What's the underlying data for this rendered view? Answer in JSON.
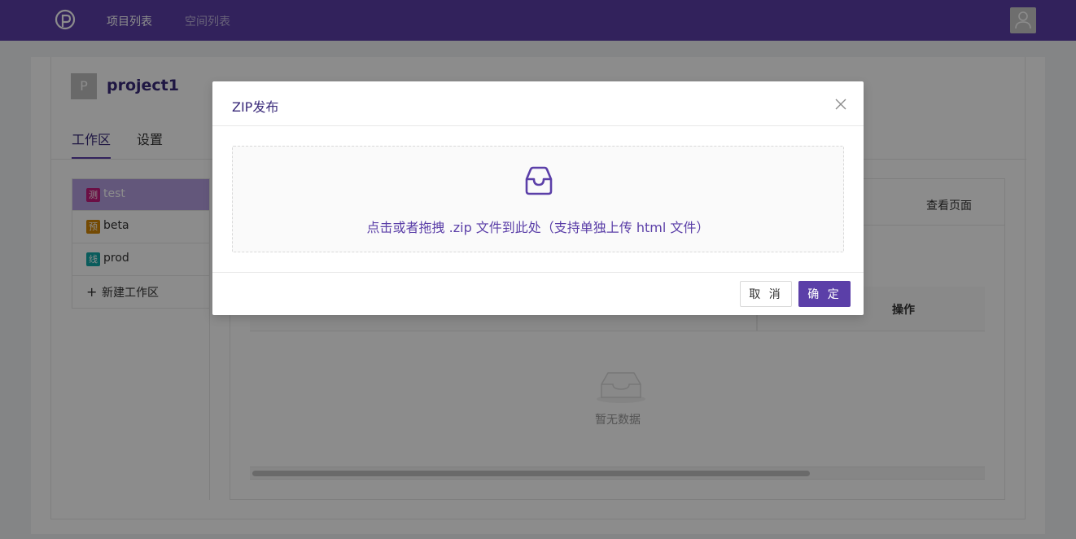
{
  "nav": {
    "projects": "项目列表",
    "spaces": "空间列表"
  },
  "project": {
    "badge": "P",
    "title": "project1"
  },
  "tabs": {
    "workspace": "工作区",
    "settings": "设置"
  },
  "workspaces": [
    {
      "tag": "测",
      "name": "test",
      "tag_color": "#c41d7f"
    },
    {
      "tag": "预",
      "name": "beta",
      "tag_color": "#d48806"
    },
    {
      "tag": "线",
      "name": "prod",
      "tag_color": "#13a8a8"
    }
  ],
  "add_workspace": "新建工作区",
  "panel": {
    "view_page": "查看页面",
    "op_column": "操作",
    "empty_text": "暂无数据"
  },
  "modal": {
    "title": "ZIP发布",
    "upload_hint": "点击或者拖拽 .zip 文件到此处（支持单独上传 html 文件）",
    "cancel": "取 消",
    "confirm": "确 定"
  },
  "colors": {
    "brand": "#5b3fa8",
    "title_text": "#3a2a7a"
  },
  "icons": {
    "close": "close-icon",
    "inbox": "inbox-icon",
    "user": "user-icon",
    "plus": "plus-icon"
  }
}
